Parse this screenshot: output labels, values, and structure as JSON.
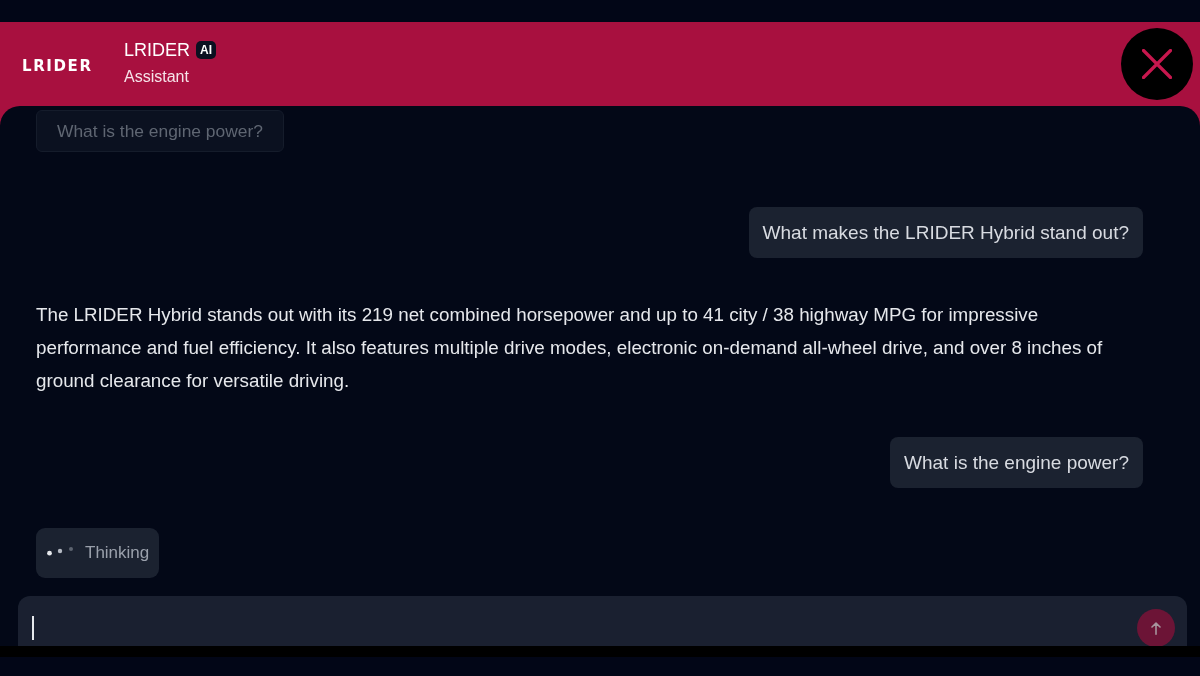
{
  "header": {
    "logo": "LRIDER",
    "title": "LRIDER",
    "badge": "AI",
    "subtitle": "Assistant"
  },
  "messages": [
    {
      "kind": "suggestion",
      "text": "What is the engine power?"
    },
    {
      "kind": "user",
      "text": "What makes the LRIDER Hybrid stand out?"
    },
    {
      "kind": "assistant",
      "text": "The LRIDER Hybrid stands out with its 219 net combined horsepower and up to 41 city / 38 highway MPG for impressive performance and fuel efficiency. It also features multiple drive modes, electronic on-demand all-wheel drive, and over 8 inches of ground clearance for versatile driving."
    },
    {
      "kind": "user",
      "text": "What is the engine power?"
    }
  ],
  "typing_indicator": {
    "label": "Thinking"
  },
  "composer": {
    "focused": true
  }
}
